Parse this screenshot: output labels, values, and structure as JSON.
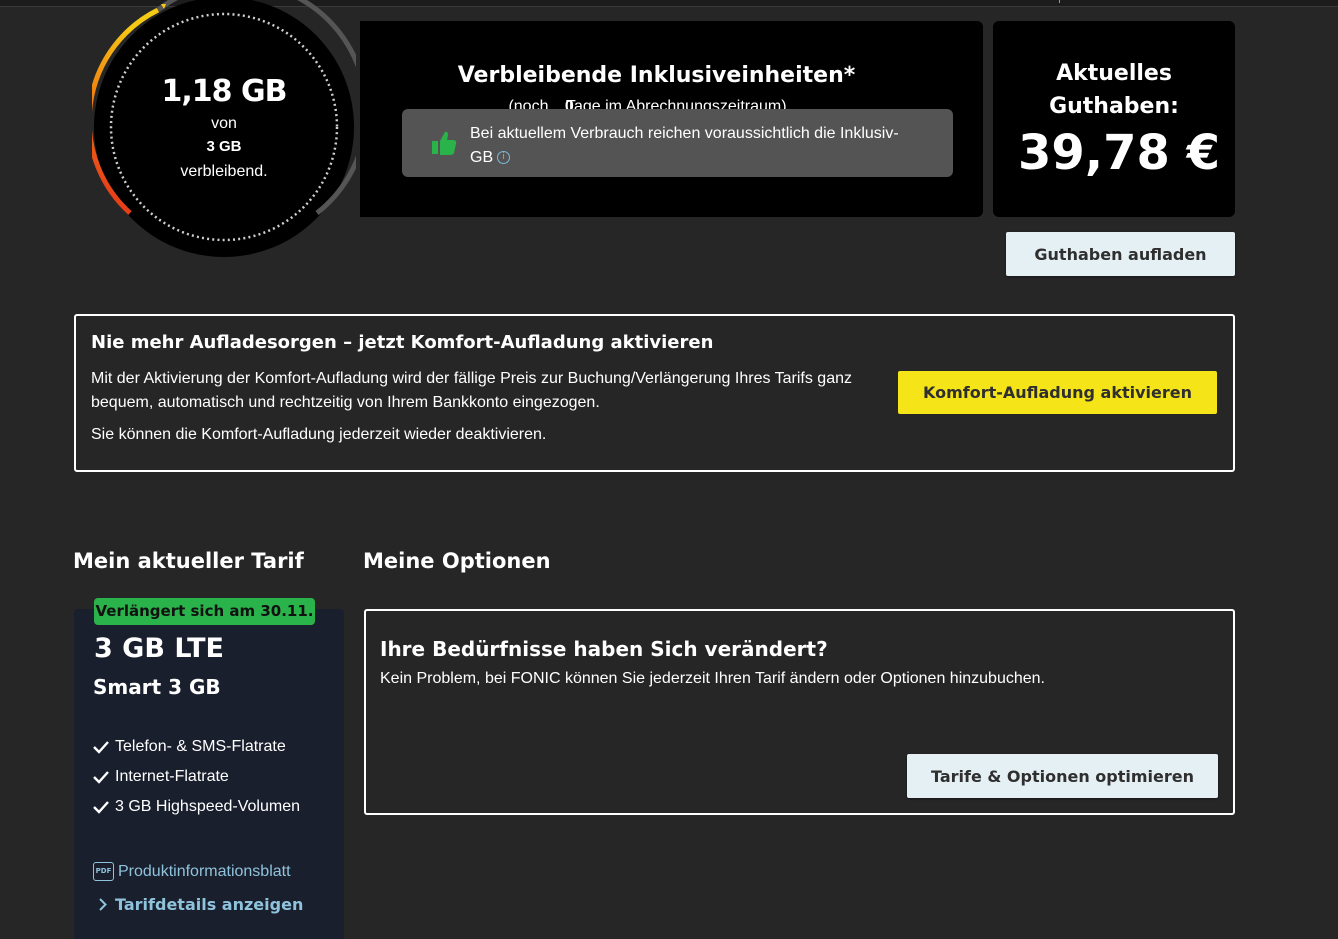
{
  "gauge": {
    "remaining_amount": "1,18 GB",
    "of_label": "von",
    "total": "3 GB",
    "remaining_label": "verbleibend.",
    "remaining_fraction": 0.39
  },
  "inclusive": {
    "title": "Verbleibende Inklusiveinheiten*",
    "subtitle_prefix": "(noch ",
    "days": "0",
    "subtitle_suffix": " Tage im Abrechnungszeitraum)",
    "forecast_message": "Bei aktuellem Verbrauch reichen voraussichtlich die Inklusiv-GB",
    "info_icon": "info-icon",
    "thumb_icon": "thumbs-up-icon"
  },
  "balance": {
    "label": "Aktuelles Guthaben:",
    "amount": "39,78 €",
    "topup_button": "Guthaben aufladen"
  },
  "comfort": {
    "title": "Nie mehr Aufladesorgen – jetzt Komfort-Aufladung aktivieren",
    "text1": "Mit der Aktivierung der Komfort-Aufladung wird der fällige Preis zur Buchung/Verlängerung Ihres Tarifs ganz bequem, automatisch und rechtzeitig von Ihrem Bankkonto eingezogen.",
    "text2": "Sie können die Komfort-Aufladung jederzeit wieder deaktivieren.",
    "button": "Komfort-Aufladung aktivieren"
  },
  "tariff": {
    "heading": "Mein aktueller Tarif",
    "renewal_badge": "Verlängert sich am 30.11.",
    "name": "3 GB LTE",
    "subname": "Smart 3 GB",
    "features": [
      "Telefon- & SMS-Flatrate",
      "Internet-Flatrate",
      "3 GB Highspeed-Volumen"
    ],
    "pdf_icon_text": "PDF",
    "pdf_link": "Produktinformationsblatt",
    "details_link": "Tarifdetails anzeigen"
  },
  "options": {
    "heading": "Meine Optionen",
    "title": "Ihre Bedürfnisse haben Sich verändert?",
    "text": "Kein Problem, bei FONIC können Sie jederzeit Ihren Tarif ändern oder Optionen hinzubuchen.",
    "button": "Tarife & Optionen optimieren"
  },
  "colors": {
    "background": "#262626",
    "panel": "#000000",
    "accent_yellow": "#f5e418",
    "badge_green": "#2ab24b",
    "link_blue": "#8fc3dc",
    "button_light": "#e5f0f5"
  }
}
